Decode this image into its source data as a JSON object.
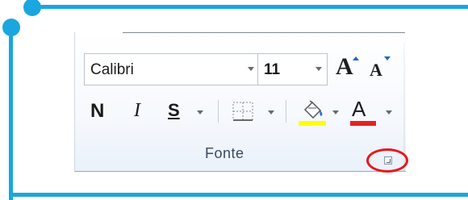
{
  "ribbon": {
    "font_name": "Calibri",
    "font_size": "11",
    "grow_font_glyph": "A",
    "shrink_font_glyph": "A",
    "bold_glyph": "N",
    "italic_glyph": "I",
    "underline_glyph": "S",
    "font_color_glyph": "A",
    "group_label": "Fonte"
  },
  "colors": {
    "frame": "#1aa6df",
    "highlight_ring": "#e32222",
    "fill_color": "#ffff00",
    "font_color": "#e32222",
    "grow_caret": "#2b63c4"
  },
  "icons": {
    "borders": "borders-icon",
    "fill": "paint-bucket-icon",
    "launcher": "dialog-launcher-icon"
  }
}
